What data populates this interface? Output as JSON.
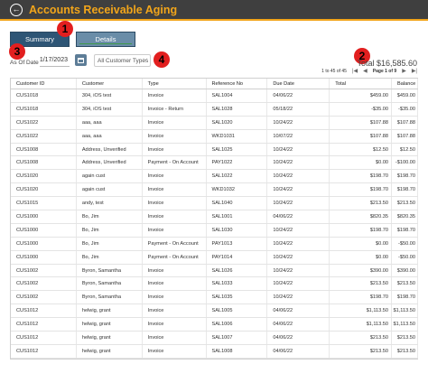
{
  "app": {
    "title": "Accounts Receivable Aging"
  },
  "tabs": [
    {
      "label": "Summary"
    },
    {
      "label": "Details"
    }
  ],
  "callouts": [
    "1",
    "2",
    "3",
    "4"
  ],
  "filters": {
    "as_of_label": "As Of Date",
    "as_of_value": "1/17/2023",
    "customer_type": "All Customer Types"
  },
  "summary": {
    "total_text": "Total $16,585.60",
    "range_text": "1 to 45 of 45",
    "page_text": "Page 1 of 9"
  },
  "colors": {
    "titlebar": "#3f3f3f",
    "accent": "#f2a51a",
    "tab_active": "#2e5575",
    "callout": "#e21f1f"
  },
  "table": {
    "columns": [
      "Customer ID",
      "Customer",
      "Type",
      "Reference No",
      "Due Date",
      "Total",
      "Balance"
    ],
    "rows": [
      [
        "CUS1018",
        "304, iOS test",
        "Invoice",
        "SAL1004",
        "04/06/22",
        "$459.00",
        "$459.00"
      ],
      [
        "CUS1018",
        "304, iOS test",
        "Invoice - Return",
        "SAL1028",
        "05/18/22",
        "-$35.00",
        "-$35.00"
      ],
      [
        "CUS1022",
        "aaa, aaa",
        "Invoice",
        "SAL1020",
        "10/24/22",
        "$107.88",
        "$107.88"
      ],
      [
        "CUS1022",
        "aaa, aaa",
        "Invoice",
        "WKD1031",
        "10/07/22",
        "$107.88",
        "$107.88"
      ],
      [
        "CUS1008",
        "Address, Unverified",
        "Invoice",
        "SAL1025",
        "10/24/22",
        "$12.50",
        "$12.50"
      ],
      [
        "CUS1008",
        "Address, Unverified",
        "Payment - On Account",
        "PAY1022",
        "10/24/22",
        "$0.00",
        "-$100.00"
      ],
      [
        "CUS1020",
        "again cust",
        "Invoice",
        "SAL1022",
        "10/24/22",
        "$198.70",
        "$198.70"
      ],
      [
        "CUS1020",
        "again cust",
        "Invoice",
        "WKD1032",
        "10/24/22",
        "$198.70",
        "$198.70"
      ],
      [
        "CUS1015",
        "andy, test",
        "Invoice",
        "SAL1040",
        "10/24/22",
        "$213.50",
        "$213.50"
      ],
      [
        "CUS1000",
        "Bo, Jim",
        "Invoice",
        "SAL1001",
        "04/06/22",
        "$820.35",
        "$820.35"
      ],
      [
        "CUS1000",
        "Bo, Jim",
        "Invoice",
        "SAL1030",
        "10/24/22",
        "$198.70",
        "$198.70"
      ],
      [
        "CUS1000",
        "Bo, Jim",
        "Payment - On Account",
        "PAY1013",
        "10/24/22",
        "$0.00",
        "-$50.00"
      ],
      [
        "CUS1000",
        "Bo, Jim",
        "Payment - On Account",
        "PAY1014",
        "10/24/22",
        "$0.00",
        "-$50.00"
      ],
      [
        "CUS1002",
        "Byron, Samantha",
        "Invoice",
        "SAL1026",
        "10/24/22",
        "$390.00",
        "$390.00"
      ],
      [
        "CUS1002",
        "Byron, Samantha",
        "Invoice",
        "SAL1033",
        "10/24/22",
        "$213.50",
        "$213.50"
      ],
      [
        "CUS1002",
        "Byron, Samantha",
        "Invoice",
        "SAL1035",
        "10/24/22",
        "$198.70",
        "$198.70"
      ],
      [
        "CUS1012",
        "helwig, grant",
        "Invoice",
        "SAL1005",
        "04/06/22",
        "$1,113.50",
        "$1,113.50"
      ],
      [
        "CUS1012",
        "helwig, grant",
        "Invoice",
        "SAL1006",
        "04/06/22",
        "$1,113.50",
        "$1,113.50"
      ],
      [
        "CUS1012",
        "helwig, grant",
        "Invoice",
        "SAL1007",
        "04/06/22",
        "$213.50",
        "$213.50"
      ],
      [
        "CUS1012",
        "helwig, grant",
        "Invoice",
        "SAL1008",
        "04/06/22",
        "$213.50",
        "$213.50"
      ]
    ]
  }
}
